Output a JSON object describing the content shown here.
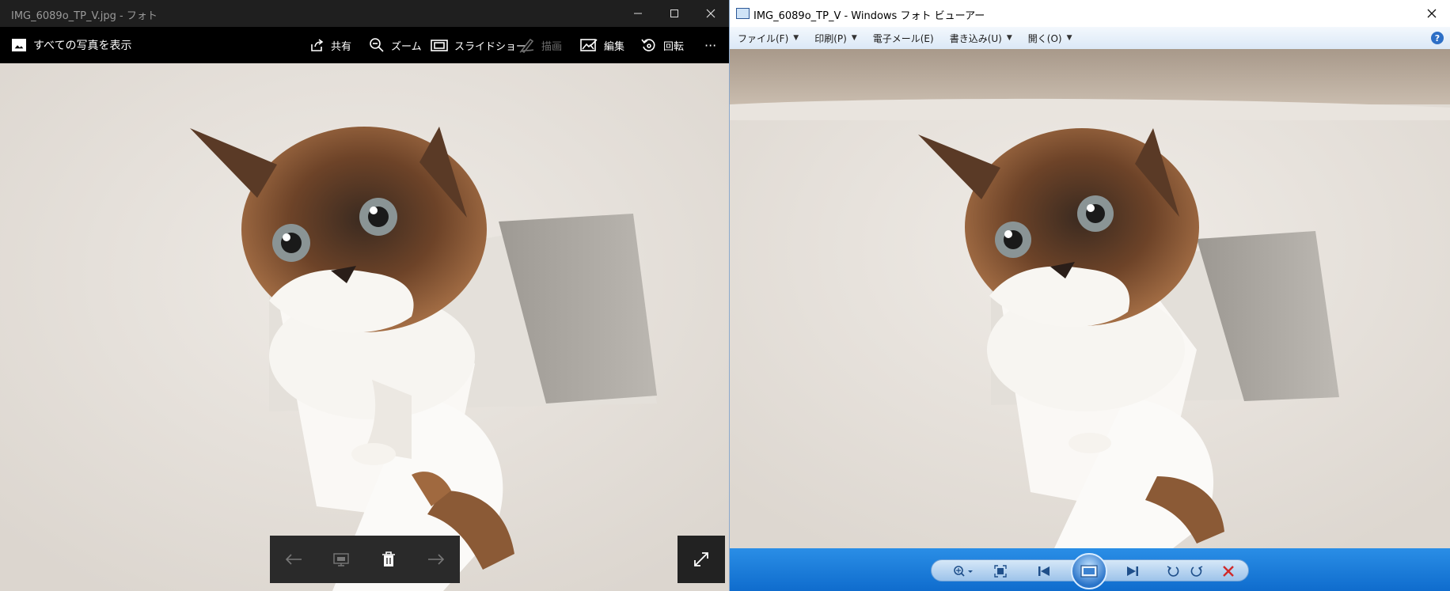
{
  "photos_app": {
    "window_title": "IMG_6089o_TP_V.jpg - フォト",
    "toolbar": {
      "see_all_label": "すべての写真を表示",
      "share_label": "共有",
      "zoom_label": "ズーム",
      "slideshow_label": "スライドショー",
      "draw_label": "描画",
      "edit_label": "編集",
      "rotate_label": "回転",
      "more_label": "···"
    }
  },
  "photo_viewer": {
    "window_title": "IMG_6089o_TP_V - Windows フォト ビューアー",
    "menu": {
      "file": "ファイル(F)",
      "print": "印刷(P)",
      "email": "電子メール(E)",
      "burn": "書き込み(U)",
      "open": "開く(O)"
    },
    "help_label": "?"
  },
  "colors": {
    "photos_titlebar": "#1f1f1f",
    "photos_toolbar": "#000000",
    "viewer_controlbar": "#1479d8",
    "delete_red": "#d02a2a"
  }
}
